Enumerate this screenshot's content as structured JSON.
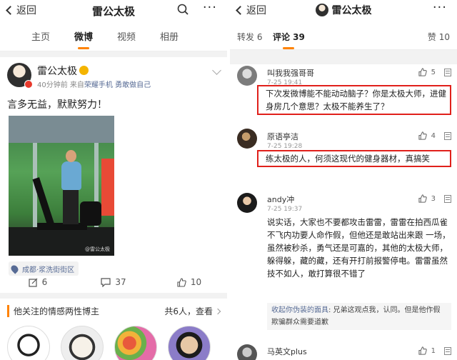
{
  "left": {
    "nav": {
      "back": "返回",
      "title": "雷公太极"
    },
    "tabs": [
      "主页",
      "微博",
      "视频",
      "相册"
    ],
    "post": {
      "author": "雷公太极",
      "time": "40分钟前",
      "source_prefix": "来自",
      "source": "荣耀手机 勇敢做自己",
      "text": "言多无益，默默努力！",
      "watermark": "@雷公太极",
      "location": "成都·浆洗街街区",
      "reposts": "6",
      "comments": "37",
      "likes": "10"
    },
    "recommend": {
      "title": "他关注的情感两性博主",
      "count": "共6人，查看"
    }
  },
  "right": {
    "nav": {
      "back": "返回",
      "title": "雷公太极"
    },
    "tabs": {
      "reposts": "转发 6",
      "comments": "评论 39",
      "likes": "赞 10"
    },
    "comments": [
      {
        "name": "叫我我强哥哥",
        "time": "7-25 19:41",
        "likes": "5",
        "text": "下次发微博能不能动动脑子？你是太极大师，进健身房几个意思？太极不能养生了？"
      },
      {
        "name": "原语亭洁",
        "time": "7-25 19:28",
        "likes": "4",
        "text": "练太极的人，何须这现代的健身器材，真搞笑"
      },
      {
        "name": "andy冲",
        "time": "7-25 19:37",
        "likes": "3",
        "text": "说实话，大家也不要都攻击雷雷，雷雷在拍西瓜雀不飞内功要人命作假，但他还是敢站出来跟 一场，虽然被秒杀，勇气还是可嘉的，其他的太极大师，躲得躲，藏的藏，还有开打前报警停电。雷雷虽然技不如人，敢打算很不错了",
        "reply_user": "收起你伪装的面具",
        "reply_text": ": 兄弟这观点我，认同。但是他作假欺骗群众需要道歉"
      },
      {
        "name": "马英文plus",
        "time": "",
        "likes": "1",
        "text": ""
      }
    ]
  },
  "colors": {
    "accent": "#ff8200",
    "highlight_box": "#e0201b",
    "link": "#576b95"
  }
}
